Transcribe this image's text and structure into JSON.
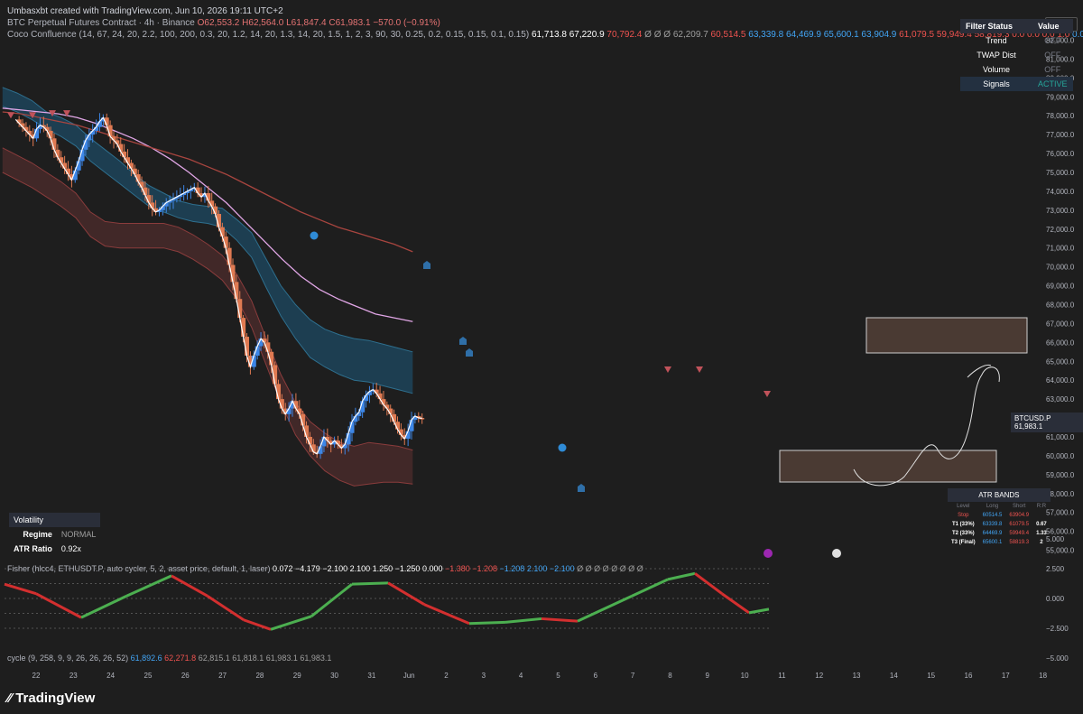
{
  "header": {
    "created": "Umbasxbt created with TradingView.com, Jun 10, 2026 19:11 UTC+2",
    "symbol": "BTC Perpetual Futures Contract · 4h · Binance",
    "ohlc": [
      "O62,553.2",
      "H62,564.0",
      "L61,847.4",
      "C61,983.1",
      "−570.0 (−0.91%)"
    ],
    "indicator": "Coco Confluence (14, 67, 24, 20, 2.2, 100, 200, 0.3, 20, 1.2, 14, 20, 1.3, 14, 20, 1.5, 1, 2, 3, 90, 30, 0.25, 0.2, 0.15, 0.15, 0.1, 0.15)",
    "indicator_values": [
      "61,713.8",
      "67,220.9",
      "70,792.4",
      "Ø",
      "Ø",
      "Ø",
      "62,209.7",
      "60,514.5",
      "63,339.8",
      "64,469.9",
      "65,600.1",
      "63,904.9",
      "61,079.5",
      "59,949.4",
      "58,819.3",
      "0.0",
      "0.0",
      "0.0",
      "1.0",
      "0.0",
      "0.0"
    ]
  },
  "currency": "USD",
  "last_price": {
    "symbol": "BTCUSD.P",
    "value": "61,983.1"
  },
  "filter_table": {
    "headers": [
      "Filter Status",
      "Value"
    ],
    "rows": [
      {
        "key": "Trend",
        "value": "OFF"
      },
      {
        "key": "TWAP Dist",
        "value": "OFF"
      },
      {
        "key": "Volume",
        "value": "OFF"
      },
      {
        "key": "Signals",
        "value": "ACTIVE"
      }
    ]
  },
  "volatility_table": {
    "title": "Volatility",
    "rows": [
      {
        "key": "Regime",
        "value": "NORMAL"
      },
      {
        "key": "ATR Ratio",
        "value": "0.92x"
      }
    ]
  },
  "atr_table": {
    "title": "ATR BANDS",
    "headers": [
      "Level",
      "Long",
      "Short",
      "R:R"
    ],
    "rows": [
      {
        "level": "Stop",
        "long": "60514.5",
        "short": "63904.9",
        "rr": ""
      },
      {
        "level": "T1 (33%)",
        "long": "63339.8",
        "short": "61079.5",
        "rr": "0.67"
      },
      {
        "level": "T2 (33%)",
        "long": "64469.9",
        "short": "59949.4",
        "rr": "1.33"
      },
      {
        "level": "T3 (Final)",
        "long": "65600.1",
        "short": "58819.3",
        "rr": "2"
      }
    ]
  },
  "fisher": {
    "label": "Fisher",
    "params": "(hlcc4, ETHUSDT.P, auto cycler, 5, 2, asset price, default, 1, laser)",
    "values": [
      "0.072",
      "−4.179",
      "−2.100",
      "2.100",
      "1.250",
      "−1.250",
      "0.000",
      "−1.380",
      "−1.208",
      "−1.208",
      "2.100",
      "−2.100",
      "Ø",
      "Ø",
      "Ø",
      "Ø",
      "Ø",
      "Ø",
      "Ø",
      "Ø"
    ],
    "axis": [
      "5.000",
      "2.500",
      "0.000",
      "−2.500",
      "−5.000"
    ]
  },
  "cycle": {
    "label": "cycle (9, 258, 9, 9, 26, 26, 26, 52)",
    "values": [
      "61,892.6",
      "62,271.8",
      "62,815.1",
      "61,818.1",
      "61,983.1",
      "61,983.1"
    ]
  },
  "branding": "TradingView",
  "chart_data": {
    "type": "candlestick",
    "timeframe": "4h",
    "yaxis": [
      "82,000.0",
      "81,000.0",
      "80,000.0",
      "79,000.0",
      "78,000.0",
      "77,000.0",
      "76,000.0",
      "75,000.0",
      "74,000.0",
      "73,000.0",
      "72,000.0",
      "71,000.0",
      "70,000.0",
      "69,000.0",
      "68,000.0",
      "67,000.0",
      "66,000.0",
      "65,000.0",
      "64,000.0",
      "63,000.0",
      "62,000.0",
      "61,000.0",
      "60,000.0",
      "59,000.0",
      "58,000.0",
      "57,000.0",
      "56,000.0",
      "55,000.0"
    ],
    "ylim": [
      54500,
      82500
    ],
    "xaxis": [
      "22",
      "23",
      "24",
      "25",
      "26",
      "27",
      "28",
      "29",
      "30",
      "31",
      "Jun",
      "2",
      "3",
      "4",
      "5",
      "6",
      "7",
      "8",
      "9",
      "10",
      "11",
      "12",
      "13",
      "14",
      "15",
      "16",
      "17",
      "18"
    ],
    "xlim": [
      0,
      27.7
    ],
    "closes": [
      77800,
      77600,
      77400,
      77200,
      77000,
      76800,
      77300,
      77500,
      77400,
      77200,
      76800,
      76200,
      75800,
      75500,
      75200,
      74900,
      74600,
      75100,
      75600,
      76200,
      76700,
      77000,
      77200,
      77400,
      77700,
      77900,
      77500,
      76900,
      76700,
      76500,
      76100,
      75800,
      75500,
      75200,
      74900,
      74500,
      74200,
      73800,
      73400,
      73100,
      72900,
      73000,
      73200,
      73400,
      73500,
      73600,
      73700,
      73800,
      73900,
      74000,
      74100,
      74200,
      73900,
      73700,
      73900,
      73500,
      73200,
      72800,
      72100,
      71600,
      71000,
      70100,
      69200,
      68300,
      67300,
      66300,
      65300,
      64700,
      65300,
      65800,
      66200,
      66000,
      65500,
      64800,
      63800,
      63000,
      62500,
      62200,
      62500,
      62900,
      62500,
      62200,
      61600,
      61000,
      60600,
      60200,
      60100,
      60500,
      61000,
      60800,
      60600,
      60800,
      60600,
      60400,
      60600,
      61200,
      61800,
      62100,
      62300,
      62900,
      63200,
      63400,
      63500,
      63300,
      63000,
      62700,
      62500,
      62200,
      61800,
      61400,
      61100,
      60900,
      61300,
      61900,
      62100,
      62000,
      61983
    ],
    "series": [
      {
        "name": "upper band 3",
        "values": [
          79500,
          79200,
          78800,
          78200,
          77900,
          77500,
          76800,
          76200,
          75600,
          74900,
          74300,
          73900,
          73500,
          73300,
          73200,
          73100,
          72500,
          71800,
          70400,
          69000,
          68000,
          67200,
          66700,
          66400,
          66200,
          66100,
          65900,
          65700,
          65500
        ]
      },
      {
        "name": "upper band 1",
        "values": [
          78500,
          78200,
          77800,
          77300,
          76900,
          76400,
          75600,
          75000,
          74400,
          73800,
          73200,
          72900,
          72600,
          72400,
          72300,
          72100,
          71400,
          70500,
          68900,
          67400,
          66200,
          65200,
          64700,
          64300,
          64000,
          63900,
          63700,
          63500,
          63300
        ]
      },
      {
        "name": "lower band 1",
        "values": [
          76300,
          75900,
          75500,
          75000,
          74500,
          73900,
          72900,
          72400,
          72300,
          72300,
          72300,
          72300,
          72100,
          71700,
          71200,
          70600,
          69600,
          68200,
          66200,
          64300,
          62800,
          61800,
          61200,
          60700,
          60500,
          60700,
          60600,
          60500,
          60300
        ]
      },
      {
        "name": "lower band 3",
        "values": [
          75000,
          74600,
          74200,
          73700,
          73200,
          72600,
          71600,
          71100,
          71000,
          71000,
          71000,
          71000,
          70800,
          70400,
          69900,
          69300,
          68300,
          66800,
          64800,
          62800,
          61100,
          60000,
          59200,
          58700,
          58400,
          58500,
          58600,
          58600,
          58500
        ]
      },
      {
        "name": "MA 100",
        "values": [
          78400,
          78300,
          78200,
          78100,
          77900,
          77600,
          77200,
          76800,
          76300,
          75700,
          75000,
          74200,
          73400,
          72400,
          71400,
          70400,
          69500,
          68800,
          68300,
          67900,
          67500,
          67300,
          67100
        ]
      },
      {
        "name": "MA 200",
        "values": [
          78200,
          78100,
          77900,
          77700,
          77500,
          77200,
          76900,
          76600,
          76300,
          76000,
          75700,
          75300,
          74900,
          74400,
          73900,
          73400,
          72900,
          72500,
          72100,
          71800,
          71500,
          71200,
          70800
        ]
      }
    ]
  }
}
